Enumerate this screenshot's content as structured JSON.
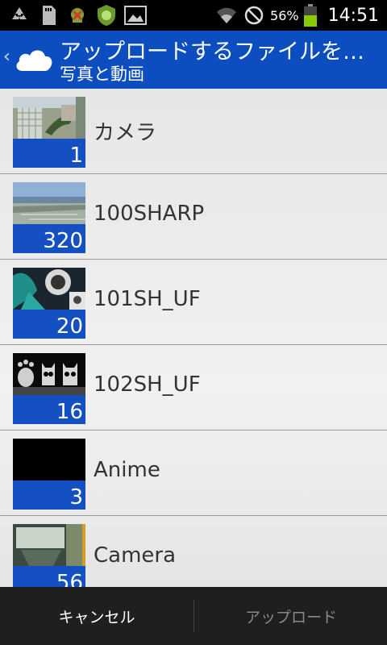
{
  "status_bar": {
    "icons": [
      "recycle-icon",
      "sd-card-icon",
      "android-blocked-icon",
      "android-shield-icon",
      "image-icon"
    ],
    "right_icons": [
      "wifi-icon",
      "no-signal-icon"
    ],
    "battery_percent": "56%",
    "battery_level": 0.56,
    "time": "14:51"
  },
  "header": {
    "title": "アップロードするファイルを…",
    "subtitle": "写真と動画",
    "brand_color": "#0c4ebf"
  },
  "folders": [
    {
      "name": "カメラ",
      "count": "1",
      "thumb": "camera-roll"
    },
    {
      "name": "100SHARP",
      "count": "320",
      "thumb": "seaside"
    },
    {
      "name": "101SH_UF",
      "count": "20",
      "thumb": "anime-art"
    },
    {
      "name": "102SH_UF",
      "count": "16",
      "thumb": "cats"
    },
    {
      "name": "Anime",
      "count": "3",
      "thumb": "black"
    },
    {
      "name": "Camera",
      "count": "56",
      "thumb": "indoor"
    }
  ],
  "footer": {
    "cancel_label": "キャンセル",
    "upload_label": "アップロード"
  }
}
